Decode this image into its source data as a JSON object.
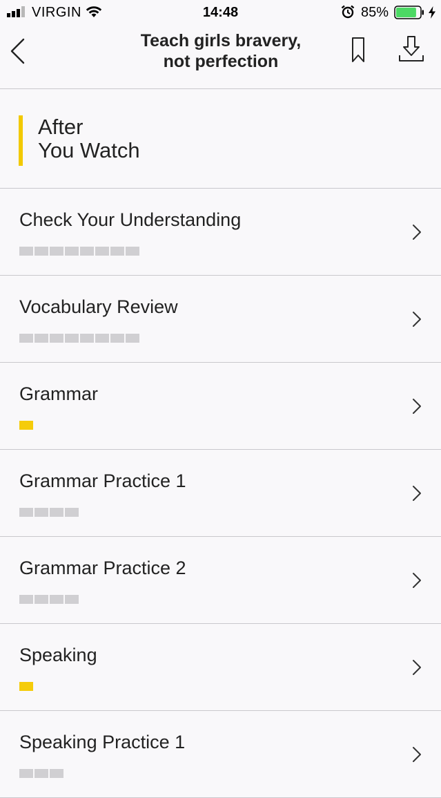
{
  "status_bar": {
    "carrier": "VIRGIN",
    "time": "14:48",
    "battery_percent": "85%",
    "battery_level": 0.85,
    "battery_color": "#4cd964"
  },
  "nav": {
    "title_line1": "Teach girls bravery,",
    "title_line2": "not perfection",
    "back_icon": "chevron-left-icon",
    "bookmark_icon": "bookmark-icon",
    "download_icon": "download-icon"
  },
  "section": {
    "heading": "After\nYou Watch",
    "accent_color": "#f2c900"
  },
  "items": [
    {
      "label": "Check Your Understanding",
      "segments": 8,
      "completed": 0
    },
    {
      "label": "Vocabulary Review",
      "segments": 8,
      "completed": 0
    },
    {
      "label": "Grammar",
      "segments": 1,
      "completed": 1
    },
    {
      "label": "Grammar Practice 1",
      "segments": 4,
      "completed": 0
    },
    {
      "label": "Grammar Practice 2",
      "segments": 4,
      "completed": 0
    },
    {
      "label": "Speaking",
      "segments": 1,
      "completed": 1
    },
    {
      "label": "Speaking Practice 1",
      "segments": 3,
      "completed": 0
    }
  ]
}
